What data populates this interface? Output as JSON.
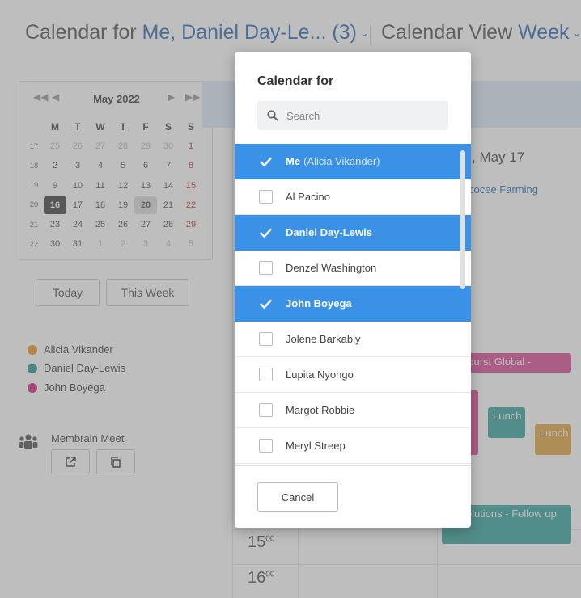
{
  "header": {
    "calendar_for_label": "Calendar for",
    "calendar_for_value": "Me, Daniel Day-Le... (3)",
    "view_label": "Calendar View",
    "view_value": "Week"
  },
  "mini_calendar": {
    "month": "May 2022",
    "weekdays": [
      "M",
      "T",
      "W",
      "T",
      "F",
      "S",
      "S"
    ],
    "weeks": [
      {
        "wk": "17",
        "days": [
          "25",
          "26",
          "27",
          "28",
          "29",
          "30",
          "1"
        ]
      },
      {
        "wk": "18",
        "days": [
          "2",
          "3",
          "4",
          "5",
          "6",
          "7",
          "8"
        ]
      },
      {
        "wk": "19",
        "days": [
          "9",
          "10",
          "11",
          "12",
          "13",
          "14",
          "15"
        ]
      },
      {
        "wk": "20",
        "days": [
          "16",
          "17",
          "18",
          "19",
          "20",
          "21",
          "22"
        ]
      },
      {
        "wk": "21",
        "days": [
          "23",
          "24",
          "25",
          "26",
          "27",
          "28",
          "29"
        ]
      },
      {
        "wk": "22",
        "days": [
          "30",
          "31",
          "1",
          "2",
          "3",
          "4",
          "5"
        ]
      }
    ]
  },
  "buttons": {
    "today": "Today",
    "this_week": "This Week"
  },
  "legend": [
    {
      "name": "Alicia Vikander",
      "color": "#e39a27"
    },
    {
      "name": "Daniel Day-Lewis",
      "color": "#2a9a93"
    },
    {
      "name": "John Boyega",
      "color": "#cc2a7f"
    }
  ],
  "meeting": {
    "label": "Membrain Meet"
  },
  "calendar": {
    "day_header": ", May 17",
    "event_text": "cocee Farming",
    "events": [
      {
        "label": "aburst Global -",
        "color": "#dd4f97"
      },
      {
        "label": "Lunch",
        "color": "#3aa7a0"
      },
      {
        "label": "Lunch",
        "color": "#e3a742"
      },
      {
        "label": "ro Solutions - Follow up",
        "color": "#3aa7a0"
      }
    ],
    "hours": [
      "15",
      "16"
    ],
    "hour_suffix": "00"
  },
  "modal": {
    "title": "Calendar for",
    "search_placeholder": "Search",
    "people": [
      {
        "name": "Me",
        "sub": "(Alicia Vikander)",
        "checked": true
      },
      {
        "name": "Al Pacino",
        "checked": false
      },
      {
        "name": "Daniel Day-Lewis",
        "checked": true
      },
      {
        "name": "Denzel Washington",
        "checked": false
      },
      {
        "name": "John Boyega",
        "checked": true
      },
      {
        "name": "Jolene Barkably",
        "checked": false
      },
      {
        "name": "Lupita Nyongo",
        "checked": false
      },
      {
        "name": "Margot Robbie",
        "checked": false
      },
      {
        "name": "Meryl Streep",
        "checked": false
      }
    ],
    "cancel_label": "Cancel"
  }
}
